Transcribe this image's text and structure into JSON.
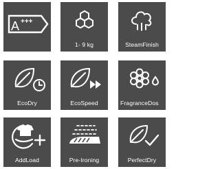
{
  "colors": {
    "tile_bg": "#4b4b4b",
    "foreground": "#ffffff",
    "page_bg": "#ffffff"
  },
  "tiles": [
    {
      "icon": "energy-class-a-plus-plus-plus-icon",
      "label": "",
      "badge_text": "A+++"
    },
    {
      "icon": "hexagon-capacity-icon",
      "label": "1- 9 kg"
    },
    {
      "icon": "steam-icon",
      "label": "SteamFinish"
    },
    {
      "icon": "eco-leaf-timer-icon",
      "label": "EcoDry"
    },
    {
      "icon": "eco-leaf-fast-forward-icon",
      "label": "EcoSpeed"
    },
    {
      "icon": "fragrance-flower-drop-icon",
      "label": "FragranceDos"
    },
    {
      "icon": "add-load-shirt-icon",
      "label": "AddLoad"
    },
    {
      "icon": "pre-ironing-icon",
      "label": "Pre-Ironing"
    },
    {
      "icon": "leaf-check-icon",
      "label": "PerfectDry"
    }
  ]
}
